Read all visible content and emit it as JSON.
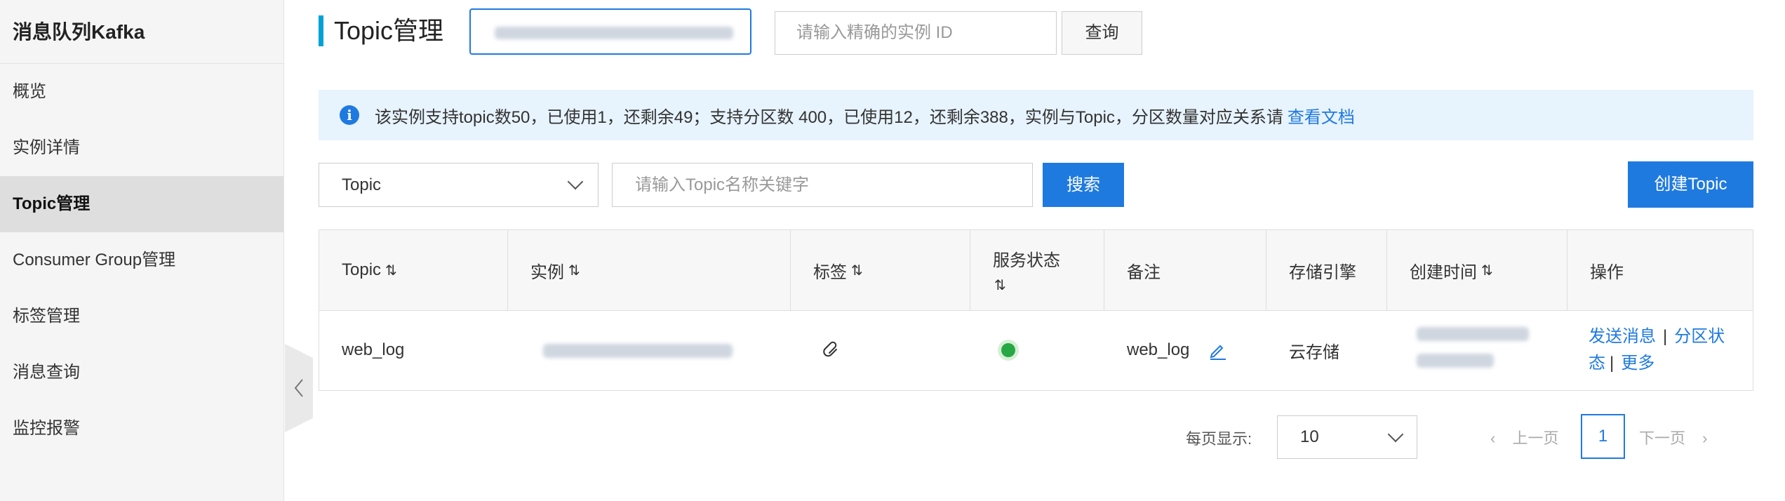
{
  "sidebar": {
    "title": "消息队列Kafka",
    "items": [
      {
        "label": "概览"
      },
      {
        "label": "实例详情"
      },
      {
        "label": "Topic管理"
      },
      {
        "label": "Consumer Group管理"
      },
      {
        "label": "标签管理"
      },
      {
        "label": "消息查询"
      },
      {
        "label": "监控报警"
      }
    ]
  },
  "header": {
    "title": "Topic管理",
    "instance_id_placeholder": "请输入精确的实例 ID",
    "query_label": "查询"
  },
  "info": {
    "text": "该实例支持topic数50，已使用1，还剩余49；支持分区数 400，已使用12，还剩余388，实例与Topic，分区数量对应关系请",
    "link": "查看文档"
  },
  "filter": {
    "type_selected": "Topic",
    "search_placeholder": "请输入Topic名称关键字",
    "search_label": "搜索",
    "create_label": "创建Topic"
  },
  "table": {
    "headers": {
      "topic": "Topic",
      "instance": "实例",
      "tags": "标签",
      "status": "服务状态",
      "remark": "备注",
      "storage": "存储引擎",
      "created": "创建时间",
      "actions": "操作"
    },
    "rows": [
      {
        "topic": "web_log",
        "remark": "web_log",
        "storage": "云存储",
        "status": "running",
        "actions": {
          "send": "发送消息",
          "partition": "分区状态",
          "more": "更多"
        }
      }
    ]
  },
  "pagination": {
    "page_size_label": "每页显示:",
    "page_size": "10",
    "prev": "上一页",
    "current_page": "1",
    "next": "下一页"
  },
  "colors": {
    "accent": "#1f7ae0",
    "status_ok": "#28a745",
    "banner_bg": "#e7f3fd"
  },
  "icons": [
    "info-icon",
    "sort-icon",
    "tag-icon",
    "edit-icon",
    "chevron-down-icon",
    "chevron-left-icon",
    "chevron-right-icon"
  ]
}
